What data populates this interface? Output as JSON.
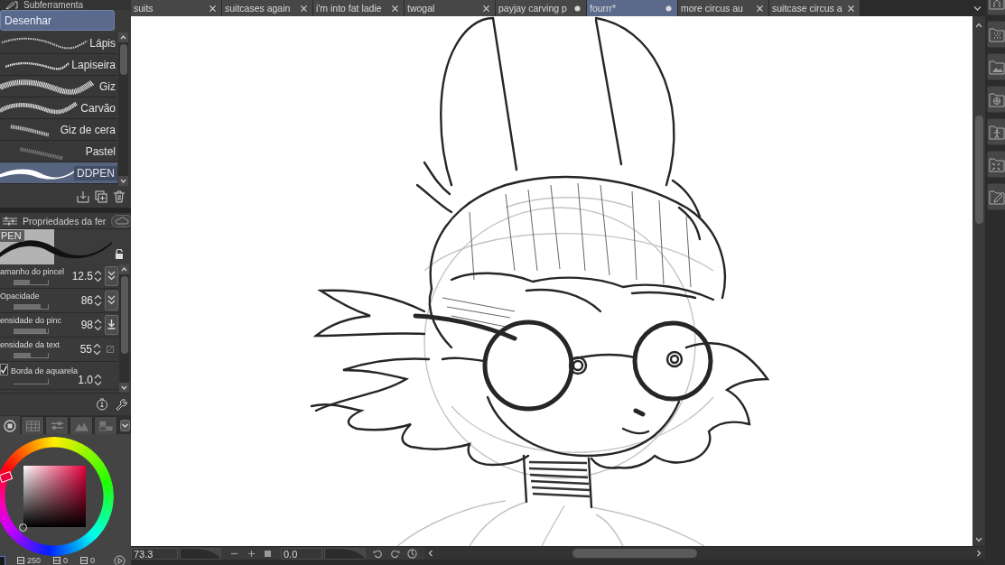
{
  "tabs": [
    {
      "label": "suits",
      "modified": false,
      "selected": false
    },
    {
      "label": "suitcases again",
      "modified": false,
      "selected": false
    },
    {
      "label": "i'm into fat ladie",
      "modified": false,
      "selected": false
    },
    {
      "label": "twogal",
      "modified": false,
      "selected": false
    },
    {
      "label": "payjay carving p",
      "modified": true,
      "selected": false
    },
    {
      "label": "fourrr*",
      "modified": true,
      "selected": true
    },
    {
      "label": "more circus au",
      "modified": false,
      "selected": false
    },
    {
      "label": "suitcase circus a",
      "modified": false,
      "selected": false
    }
  ],
  "subtool_panel": {
    "title": "Subferramenta",
    "group": "Desenhar",
    "brushes": [
      {
        "label": "Lápis",
        "kind": "pencil",
        "selected": false
      },
      {
        "label": "Lapiseira",
        "kind": "mechanical",
        "selected": false
      },
      {
        "label": "Giz",
        "kind": "chalk",
        "selected": false
      },
      {
        "label": "Carvão",
        "kind": "charcoal",
        "selected": false
      },
      {
        "label": "Giz de cera",
        "kind": "crayon",
        "selected": false
      },
      {
        "label": "Pastel",
        "kind": "pastel",
        "selected": false
      },
      {
        "label": "DDPEN",
        "kind": "pen",
        "selected": true
      }
    ]
  },
  "tool_property_panel": {
    "title": "Propriedades da fer",
    "preview_label": "PEN",
    "properties": [
      {
        "label": "amanho do pincel",
        "value": "12.5",
        "level": 0.47,
        "kind": "pressure"
      },
      {
        "label": "Opacidade",
        "value": "86",
        "level": 0.8,
        "kind": "pressure"
      },
      {
        "label": "ensidade do pinc",
        "value": "98",
        "level": 0.96,
        "kind": "effect"
      },
      {
        "label": "ensidade da text",
        "value": "55",
        "level": 0.5,
        "kind": "texture"
      }
    ],
    "watercolor_edge": {
      "label": "Borda de aquarela",
      "checked": true,
      "value": "1.0"
    }
  },
  "color_panel": {
    "tabs": [
      {
        "kind": "wheel",
        "selected": true
      },
      {
        "kind": "set",
        "selected": false
      },
      {
        "kind": "sliders",
        "selected": false
      },
      {
        "kind": "history",
        "selected": false
      },
      {
        "kind": "mixing",
        "selected": false
      }
    ],
    "readouts": [
      "250",
      "0",
      "0"
    ]
  },
  "status_bar": {
    "zoom": "73.3",
    "angle": "0.0"
  }
}
